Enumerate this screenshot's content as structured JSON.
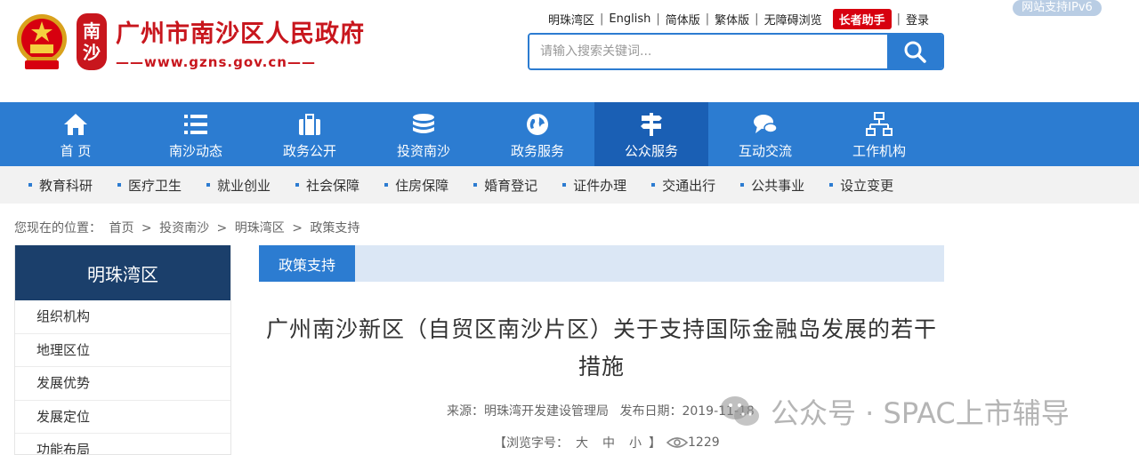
{
  "header": {
    "site_title": "广州市南沙区人民政府",
    "site_url": "——www.gzns.gov.cn——",
    "seal_chars": [
      "南",
      "沙"
    ],
    "toplinks": [
      "明珠湾区",
      "English",
      "简体版",
      "繁体版",
      "无障碍浏览"
    ],
    "elder_button": "长者助手",
    "login": "登录",
    "ipv6_badge": "网站支持IPv6",
    "search_placeholder": "请输入搜索关键词..."
  },
  "nav": {
    "items": [
      {
        "label": "首 页",
        "icon": "home-icon"
      },
      {
        "label": "南沙动态",
        "icon": "list-icon"
      },
      {
        "label": "政务公开",
        "icon": "briefcase-icon"
      },
      {
        "label": "投资南沙",
        "icon": "coins-icon"
      },
      {
        "label": "政务服务",
        "icon": "globe-icon"
      },
      {
        "label": "公众服务",
        "icon": "signpost-icon",
        "active": true
      },
      {
        "label": "互动交流",
        "icon": "chat-icon"
      },
      {
        "label": "工作机构",
        "icon": "org-chart-icon"
      }
    ]
  },
  "subnav": {
    "items": [
      "教育科研",
      "医疗卫生",
      "就业创业",
      "社会保障",
      "住房保障",
      "婚育登记",
      "证件办理",
      "交通出行",
      "公共事业",
      "设立变更"
    ]
  },
  "breadcrumb": {
    "prefix": "您现在的位置：",
    "items": [
      "首页",
      "投资南沙",
      "明珠湾区",
      "政策支持"
    ],
    "separator": ">"
  },
  "sidebar": {
    "title": "明珠湾区",
    "items": [
      "组织机构",
      "地理区位",
      "发展优势",
      "发展定位",
      "功能布局"
    ]
  },
  "content": {
    "tab_label": "政策支持",
    "title": "广州南沙新区（自贸区南沙片区）关于支持国际金融岛发展的若干措施",
    "source_label": "来源：明珠湾开发建设管理局",
    "date_label": "发布日期：2019-11-18",
    "font_size_label": "【浏览字号：",
    "font_sizes": [
      "大",
      "中",
      "小"
    ],
    "font_size_close": "】",
    "views": "1229"
  },
  "watermark": "公众号 · SPAC上市辅导",
  "colors": {
    "brand_red": "#c8161d",
    "nav_blue": "#2c7cd1",
    "nav_active": "#1a5fb4",
    "sidebar_head": "#1b3f6b"
  }
}
